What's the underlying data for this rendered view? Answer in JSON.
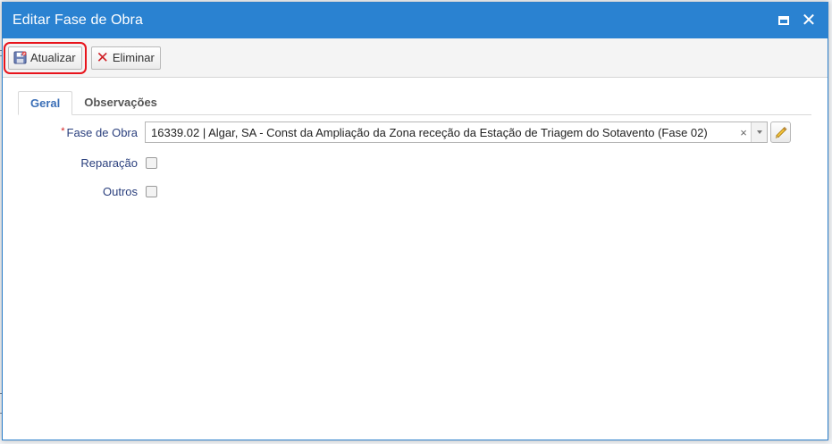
{
  "dialog": {
    "title": "Editar Fase de Obra"
  },
  "toolbar": {
    "update_label": "Atualizar",
    "delete_label": "Eliminar"
  },
  "tabs": [
    {
      "label": "Geral",
      "active": true
    },
    {
      "label": "Observações",
      "active": false
    }
  ],
  "form": {
    "required_marker": "*",
    "fase_label": "Fase de Obra",
    "fase_value": "16339.02 | Algar, SA - Const da Ampliação da Zona receção da Estação de Triagem do Sotavento (Fase 02)",
    "clear_glyph": "×",
    "reparacao_label": "Reparação",
    "reparacao_checked": false,
    "outros_label": "Outros",
    "outros_checked": false
  },
  "colors": {
    "titlebar": "#2a82d1",
    "label_text": "#2a3f7d",
    "active_tab": "#3b6fb7",
    "highlight": "#e8141c",
    "delete_icon": "#cf2027"
  }
}
